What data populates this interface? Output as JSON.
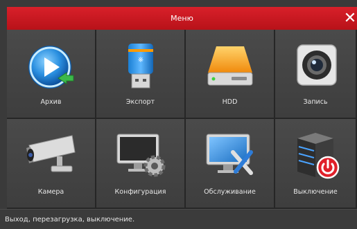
{
  "window": {
    "title": "Меню",
    "close_symbol": "✕"
  },
  "tiles": [
    {
      "label": "Архив",
      "icon": "archive-play-icon"
    },
    {
      "label": "Экспорт",
      "icon": "usb-drive-icon"
    },
    {
      "label": "HDD",
      "icon": "hdd-icon"
    },
    {
      "label": "Запись",
      "icon": "record-camera-icon"
    },
    {
      "label": "Камера",
      "icon": "cctv-camera-icon"
    },
    {
      "label": "Конфигурация",
      "icon": "monitor-gear-icon"
    },
    {
      "label": "Обслуживание",
      "icon": "monitor-tools-icon"
    },
    {
      "label": "Выключение",
      "icon": "server-power-icon"
    }
  ],
  "status": {
    "text": "Выход, перезагрузка, выключение."
  },
  "colors": {
    "title_bar": "#c8161f",
    "tile_bg": "#444444",
    "text": "#e8e8e8"
  }
}
